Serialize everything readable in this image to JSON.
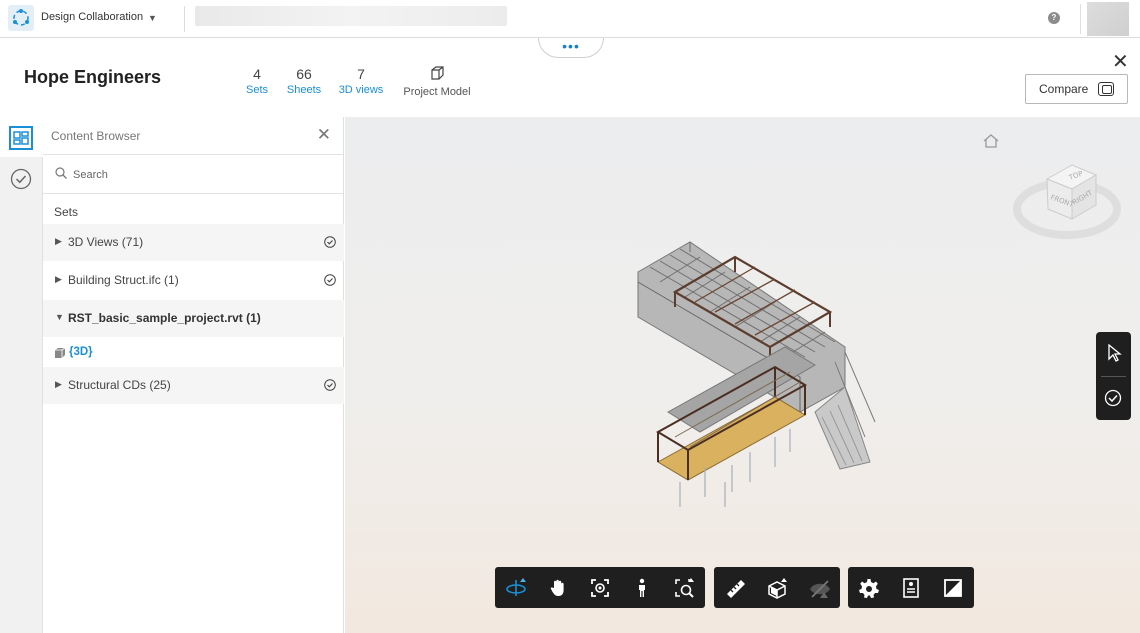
{
  "topbar": {
    "app_name": "Design Collaboration",
    "help_label": "?"
  },
  "project": {
    "title": "Hope Engineers",
    "stats": [
      {
        "value": "4",
        "label": "Sets"
      },
      {
        "value": "66",
        "label": "Sheets"
      },
      {
        "value": "7",
        "label": "3D views"
      }
    ],
    "project_model_label": "Project Model",
    "compare_label": "Compare"
  },
  "browser": {
    "title": "Content Browser",
    "search_placeholder": "Search",
    "sets_label": "Sets",
    "items": [
      {
        "label": "3D Views (71)",
        "arrow": "▶"
      },
      {
        "label": "Building Struct.ifc (1)",
        "arrow": "▶"
      },
      {
        "label": "RST_basic_sample_project.rvt (1)",
        "arrow": "▼"
      },
      {
        "label": "{3D}"
      },
      {
        "label": "Structural CDs (25)",
        "arrow": "▶"
      }
    ]
  },
  "viewer": {
    "viewcube_faces": {
      "top": "TOP",
      "front": "FRONT",
      "right": "RIGHT"
    }
  },
  "colors": {
    "accent": "#1a8fd6",
    "toolbar_bg": "#1f1f1f"
  },
  "icons": {
    "toolbar": [
      "orbit-icon",
      "pan-icon",
      "fit-to-view-icon",
      "first-person-icon",
      "zoom-window-icon",
      "measure-icon",
      "section-box-icon",
      "hide-icon",
      "settings-icon",
      "properties-icon",
      "fullscreen-icon"
    ]
  }
}
